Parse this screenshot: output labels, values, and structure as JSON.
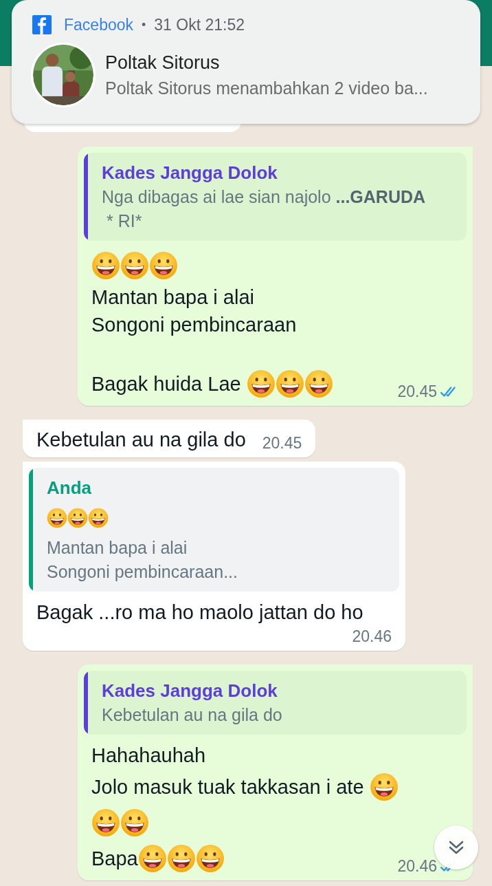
{
  "notification": {
    "app": "Facebook",
    "separator": "•",
    "time": "31 Okt 21:52",
    "sender": "Poltak Sitorus",
    "text": "Poltak Sitorus menambahkan 2 video ba..."
  },
  "messages": [
    {
      "kind": "outgoing",
      "quote": {
        "author": "Kades Jangga Dolok",
        "color": "#5b3fd6",
        "lines": [
          [
            {
              "kind": "text",
              "text": "Nga dibagas ai lae sian najolo "
            },
            {
              "kind": "bold",
              "text": "...GARUDA"
            },
            {
              "kind": "text",
              "text": " * RI*"
            }
          ]
        ]
      },
      "lines": [
        {
          "kind": "text",
          "parts": [
            {
              "kind": "emoji"
            },
            {
              "kind": "emoji"
            },
            {
              "kind": "emoji"
            }
          ]
        },
        {
          "kind": "text",
          "parts": [
            {
              "kind": "text",
              "text": "Mantan bapa i alai"
            }
          ]
        },
        {
          "kind": "text",
          "parts": [
            {
              "kind": "text",
              "text": "Songoni pembincaraan"
            }
          ]
        },
        {
          "kind": "blank"
        },
        {
          "kind": "text",
          "parts": [
            {
              "kind": "text",
              "text": "Bagak huida Lae "
            },
            {
              "kind": "emoji"
            },
            {
              "kind": "emoji"
            },
            {
              "kind": "emoji"
            }
          ]
        }
      ],
      "time": "20.45",
      "read": true
    },
    {
      "kind": "incoming",
      "lines": [
        {
          "kind": "text",
          "parts": [
            {
              "kind": "text",
              "text": "Kebetulan au na gila do"
            }
          ]
        }
      ],
      "time": "20.45"
    },
    {
      "kind": "incoming",
      "quote": {
        "author": "Anda",
        "color": "#06a07f",
        "lines": [
          [
            {
              "kind": "emoji"
            },
            {
              "kind": "emoji"
            },
            {
              "kind": "emoji"
            }
          ],
          [
            {
              "kind": "text",
              "text": "Mantan bapa i alai"
            }
          ],
          [
            {
              "kind": "text",
              "text": "Songoni pembincaraan..."
            }
          ]
        ]
      },
      "lines": [
        {
          "kind": "text",
          "parts": [
            {
              "kind": "text",
              "text": "Bagak ...ro ma ho maolo jattan do ho"
            }
          ]
        }
      ],
      "time": "20.46"
    },
    {
      "kind": "outgoing",
      "quote": {
        "author": "Kades Jangga Dolok",
        "color": "#5b3fd6",
        "lines": [
          [
            {
              "kind": "text",
              "text": "Kebetulan au na gila do"
            }
          ]
        ]
      },
      "lines": [
        {
          "kind": "text",
          "parts": [
            {
              "kind": "text",
              "text": "Hahahauhah"
            }
          ]
        },
        {
          "kind": "text",
          "parts": [
            {
              "kind": "text",
              "text": "Jolo masuk tuak takkasan i ate "
            },
            {
              "kind": "emoji"
            }
          ]
        },
        {
          "kind": "text",
          "parts": [
            {
              "kind": "emoji"
            },
            {
              "kind": "emoji"
            }
          ]
        },
        {
          "kind": "text",
          "parts": [
            {
              "kind": "text",
              "text": "Bapa"
            },
            {
              "kind": "emoji"
            },
            {
              "kind": "emoji"
            },
            {
              "kind": "emoji"
            }
          ]
        }
      ],
      "time": "20.46",
      "read": true
    }
  ]
}
